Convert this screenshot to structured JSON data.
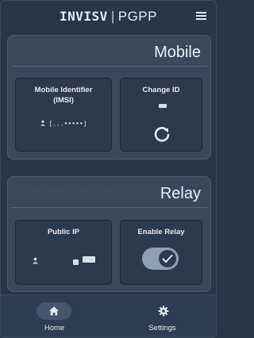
{
  "header": {
    "brand_name": "INVISV",
    "separator": "|",
    "brand_sub": "PGPP"
  },
  "mobile_section": {
    "title": "Mobile",
    "identifier_card": {
      "title": "Mobile Identifier (IMSI)",
      "value": "[...•••••]"
    },
    "change_id_card": {
      "title": "Change ID"
    }
  },
  "relay_section": {
    "title": "Relay",
    "public_ip_card": {
      "title": "Public IP"
    },
    "enable_relay_card": {
      "title": "Enable Relay",
      "enabled": true
    }
  },
  "nav": {
    "home_label": "Home",
    "settings_label": "Settings",
    "active": "home"
  },
  "icons": {
    "menu": "hamburger-icon",
    "refresh": "refresh-icon",
    "person": "person-icon",
    "check": "check-icon",
    "home": "home-icon",
    "settings": "gear-icon"
  },
  "colors": {
    "background": "#2a3548",
    "panel": "#3b475b",
    "card": "#2d394d",
    "toggle_track": "#8fa0b6",
    "text": "#e6eaf0"
  }
}
